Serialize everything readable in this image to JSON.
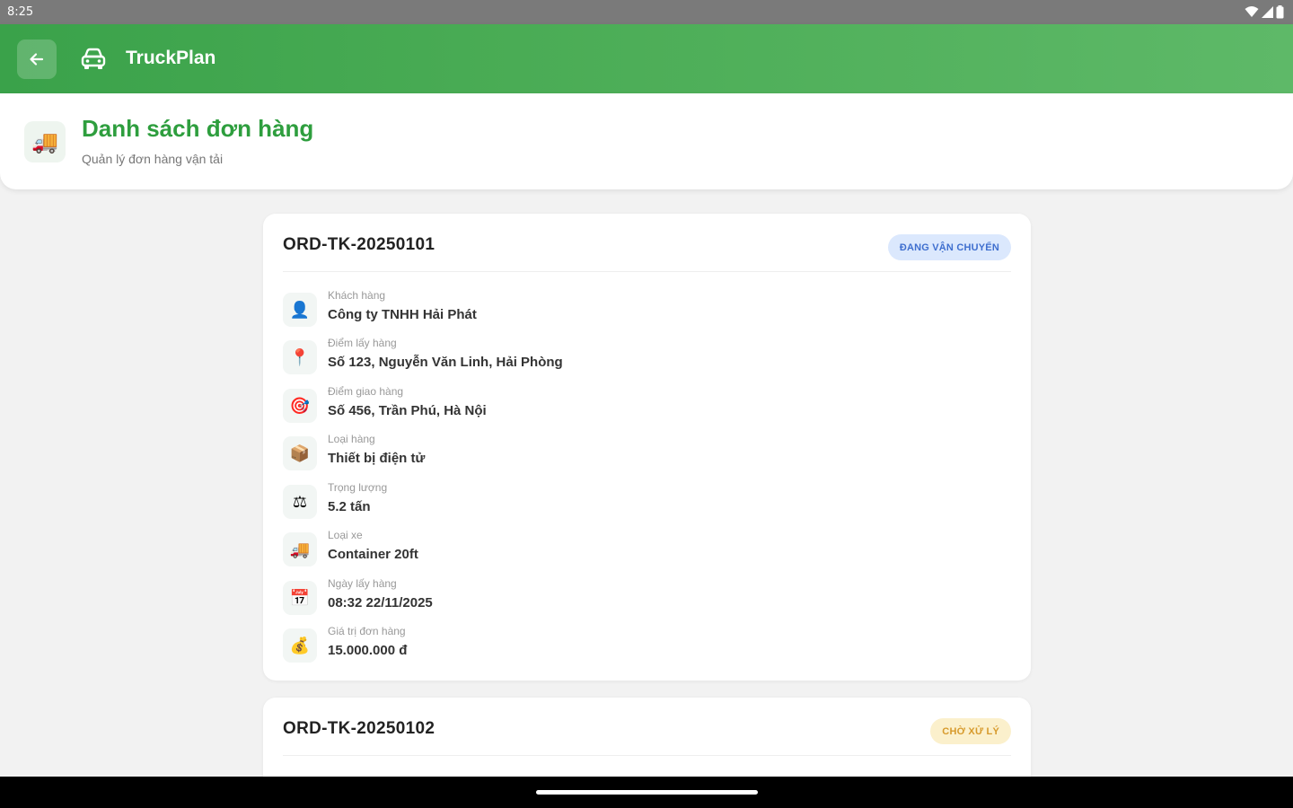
{
  "status_bar": {
    "time": "8:25"
  },
  "app_bar": {
    "title": "TruckPlan",
    "brand_color": "#3aa24a"
  },
  "header": {
    "icon": "truck-icon",
    "title": "Danh sách đơn hàng",
    "subtitle": "Quản lý đơn hàng vận tải"
  },
  "orders": [
    {
      "id": "ORD-TK-20250101",
      "status": "ĐANG VẬN CHUYỂN",
      "status_color": "#3f6fcf",
      "fields": [
        {
          "icon": "user-icon",
          "glyph": "👤",
          "label": "Khách hàng",
          "value": "Công ty TNHH Hải Phát"
        },
        {
          "icon": "pin-icon",
          "glyph": "📍",
          "label": "Điểm lấy hàng",
          "value": "Số 123, Nguyễn Văn Linh, Hải Phòng"
        },
        {
          "icon": "target-icon",
          "glyph": "🎯",
          "label": "Điểm giao hàng",
          "value": "Số 456, Trần Phú, Hà Nội"
        },
        {
          "icon": "package-icon",
          "glyph": "📦",
          "label": "Loại hàng",
          "value": "Thiết bị điện tử"
        },
        {
          "icon": "scale-icon",
          "glyph": "⚖",
          "label": "Trọng lượng",
          "value": "5.2 tấn"
        },
        {
          "icon": "truck-icon",
          "glyph": "🚚",
          "label": "Loại xe",
          "value": "Container 20ft"
        },
        {
          "icon": "calendar-icon",
          "glyph": "📅",
          "label": "Ngày lấy hàng",
          "value": "08:32 22/11/2025"
        },
        {
          "icon": "money-bag-icon",
          "glyph": "💰",
          "label": "Giá trị đơn hàng",
          "value": "15.000.000 đ"
        }
      ]
    },
    {
      "id": "ORD-TK-20250102",
      "status": "CHỜ XỬ LÝ",
      "status_color": "#d79a2c"
    }
  ]
}
